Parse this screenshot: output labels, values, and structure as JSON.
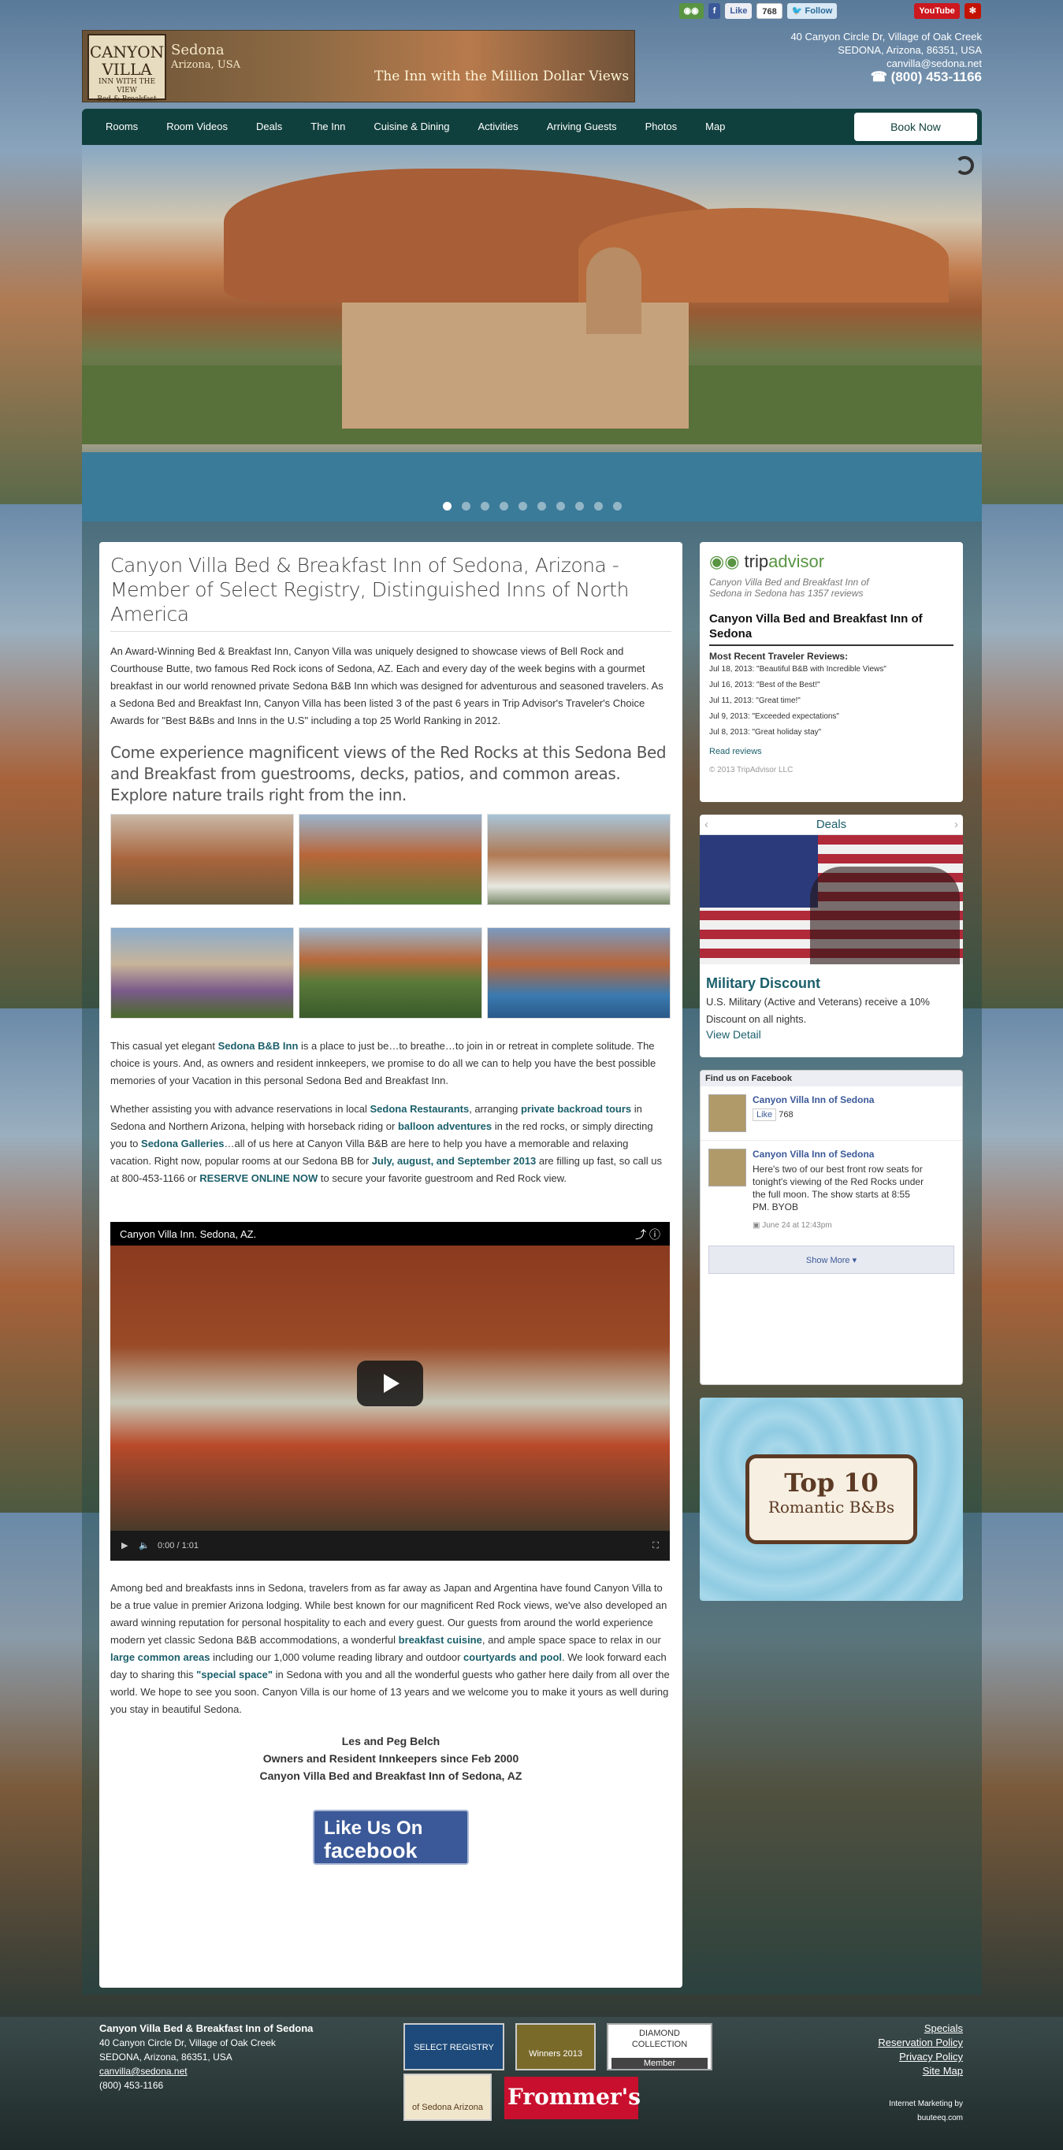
{
  "colors": {
    "nav": "#10403d",
    "link": "#1b5f6b",
    "facebook": "#3b5998",
    "tripadvisor_green": "#589442"
  },
  "social": {
    "tripadvisor_icon": "tripadvisor-icon",
    "facebook_icon": "facebook-icon",
    "like_label": "Like",
    "like_count": "768",
    "follow_label": "Follow",
    "youtube_label": "YouTube",
    "yelp_icon": "yelp-icon"
  },
  "header": {
    "logo_text": "CANYON VILLA",
    "logo_tag": "INN WITH THE VIEW",
    "logo_tag2": "Bed & Breakfast",
    "place": "Sedona",
    "state": "Arizona, USA",
    "tagline": "The Inn with the Million Dollar Views",
    "address": "40 Canyon Circle Dr, Village of Oak Creek",
    "city": "SEDONA, Arizona, 86351, USA",
    "email": "canvilla@sedona.net",
    "phone": "(800) 453-1166",
    "phone_icon": "phone-icon"
  },
  "nav": {
    "items": [
      "Rooms",
      "Room Videos",
      "Deals",
      "The Inn",
      "Cuisine & Dining",
      "Activities",
      "Arriving Guests",
      "Photos",
      "Map"
    ],
    "book": "Book Now"
  },
  "hero": {
    "slides": 10,
    "active_slide": 1
  },
  "main": {
    "title": "Canyon Villa Bed & Breakfast Inn of Sedona, Arizona - Member of Select Registry, Distinguished Inns of North America",
    "intro": "An Award-Winning Bed & Breakfast Inn, Canyon Villa was uniquely designed to showcase views of Bell Rock and Courthouse Butte, two famous Red Rock icons of Sedona, AZ. Each and every day of the week begins with a gourmet breakfast in our world renowned private Sedona B&B Inn which was designed for adventurous and seasoned travelers. As a Sedona Bed and Breakfast Inn, Canyon Villa has been listed 3 of the past 6 years in Trip Advisor's Traveler's Choice Awards for \"Best B&Bs and Inns in the U.S\" including a top 25 World Ranking in 2012.",
    "subtitle": "Come experience magnificent views of the Red Rocks at this Sedona Bed and Breakfast from guestrooms, decks, patios, and common areas. Explore nature trails right from the inn.",
    "p2a": "This casual yet elegant ",
    "p2link": "Sedona B&B Inn",
    "p2b": " is a place to just be…to breathe…to join in or retreat in complete solitude. The choice is yours.  And, as owners and resident innkeepers, we promise to do all we can to help you have the best possible memories of  your Vacation in this personal Sedona Bed and Breakfast Inn.",
    "p3a": "Whether assisting you with advance reservations in local ",
    "p3l1": "Sedona Restaurants",
    "p3b": ", arranging ",
    "p3l2": "private backroad tours",
    "p3c": " in Sedona and Northern Arizona, helping with horseback riding or ",
    "p3l3": "balloon adventures",
    "p3d": " in the red rocks, or simply directing you to ",
    "p3l4": "Sedona Galleries",
    "p3e": "…all of us here at Canyon Villa B&B are here to help you have a memorable and relaxing vacation.  Right now, popular rooms at our Sedona BB for ",
    "p3l5": "July, august, and September 2013",
    "p3f": " are filling up fast, so call us at 800-453-1166 or ",
    "p3l6": "RESERVE ONLINE NOW",
    "p3g": " to secure your favorite guestroom and Red Rock view.",
    "video_title": "Canyon Villa Inn. Sedona, AZ.",
    "video_time": "0:00 / 1:01",
    "p4a": "Among bed and breakfasts inns in Sedona, travelers from as far away as Japan and Argentina have found Canyon Villa to be a true value in premier Arizona lodging. While best known for our magnificent Red Rock views, we've also developed an award winning reputation for personal hospitality to each and every guest.  Our guests from around the world experience  modern yet classic Sedona B&B accommodations, a wonderful ",
    "p4l1": "breakfast cuisine",
    "p4b": ", and ample space space to relax in our ",
    "p4l2": "large common areas",
    "p4c": " including our 1,000 volume reading library and outdoor ",
    "p4l3": "courtyards and pool",
    "p4d": ".   We look forward each day to sharing this ",
    "p4l4": "\"special space\"",
    "p4e": " in Sedona with you and all the wonderful guests who gather here daily from all over the world. We hope to see you soon.  Canyon Villa is our home of 13 years and we welcome you to make it yours as well during you stay in beautiful Sedona.",
    "sig1": "Les and Peg Belch",
    "sig2": "Owners and Resident Innkeepers since Feb 2000",
    "sig3": "Canyon Villa Bed and Breakfast Inn of Sedona, AZ",
    "fb_btn1": "Like Us On",
    "fb_btn2": "facebook"
  },
  "sidebar": {
    "ta_logo_a": "trip",
    "ta_logo_b": "advisor",
    "ta_sub": "Canyon Villa Bed and Breakfast Inn of Sedona in Sedona has 1357 reviews",
    "ta_name": "Canyon Villa Bed and Breakfast Inn of Sedona",
    "ta_head": "Most Recent Traveler Reviews:",
    "reviews": [
      "Jul 18, 2013: \"Beautiful B&B with Incredible Views\"",
      "Jul 16, 2013: \"Best of the Best!\"",
      "Jul 11, 2013: \"Great time!\"",
      "Jul 9, 2013: \"Exceeded expectations\"",
      "Jul 8, 2013: \"Great holiday stay\""
    ],
    "ta_more": "Read reviews",
    "ta_copy": "© 2013 TripAdvisor LLC",
    "deals_title": "Deals",
    "deal_name": "Military Discount",
    "deal_text": "U.S. Military (Active and Veterans) receive a 10% Discount on all nights.",
    "deal_link": "View Detail",
    "fb_head": "Find us on Facebook",
    "fb_page": "Canyon Villa Inn of Sedona",
    "fb_like": "Like",
    "fb_count": "768",
    "fb_post": "Here's two of our best front row seats for tonight's viewing of the Red Rocks under the full moon. The show starts at 8:55 PM. BYOB",
    "fb_time": "June 24 at 12:43pm",
    "fb_more": "Show More",
    "top10_a": "Top 10",
    "top10_b": "Romantic B&Bs"
  },
  "footer": {
    "name": "Canyon Villa Bed & Breakfast Inn of Sedona",
    "addr": "40 Canyon Circle Dr, Village of Oak Creek",
    "city": "SEDONA, Arizona, 86351, USA",
    "email": "canvilla@sedona.net",
    "phone": "(800) 453-1166",
    "links": [
      "Specials",
      "Reservation Policy",
      "Privacy Policy",
      "Site Map"
    ],
    "im": "Internet Marketing by",
    "im2": "buuteeq.com",
    "badge_select": "SELECT REGISTRY",
    "badge_bb": "Winners 2013",
    "badge_diamond": "DIAMOND COLLECTION",
    "badge_diamond_sub": "Member",
    "badge_premier": "of Sedona Arizona",
    "badge_frommers": "Frommer's"
  }
}
